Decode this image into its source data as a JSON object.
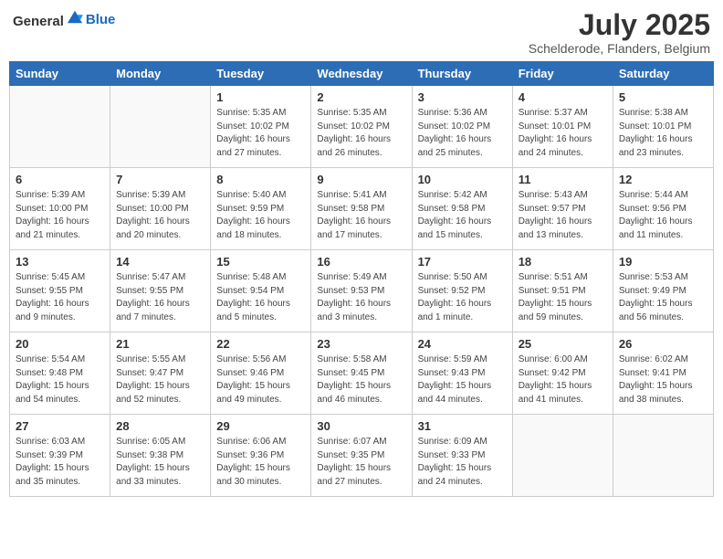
{
  "logo": {
    "general": "General",
    "blue": "Blue"
  },
  "header": {
    "month": "July 2025",
    "location": "Schelderode, Flanders, Belgium"
  },
  "weekdays": [
    "Sunday",
    "Monday",
    "Tuesday",
    "Wednesday",
    "Thursday",
    "Friday",
    "Saturday"
  ],
  "weeks": [
    [
      {
        "day": "",
        "info": ""
      },
      {
        "day": "",
        "info": ""
      },
      {
        "day": "1",
        "info": "Sunrise: 5:35 AM\nSunset: 10:02 PM\nDaylight: 16 hours and 27 minutes."
      },
      {
        "day": "2",
        "info": "Sunrise: 5:35 AM\nSunset: 10:02 PM\nDaylight: 16 hours and 26 minutes."
      },
      {
        "day": "3",
        "info": "Sunrise: 5:36 AM\nSunset: 10:02 PM\nDaylight: 16 hours and 25 minutes."
      },
      {
        "day": "4",
        "info": "Sunrise: 5:37 AM\nSunset: 10:01 PM\nDaylight: 16 hours and 24 minutes."
      },
      {
        "day": "5",
        "info": "Sunrise: 5:38 AM\nSunset: 10:01 PM\nDaylight: 16 hours and 23 minutes."
      }
    ],
    [
      {
        "day": "6",
        "info": "Sunrise: 5:39 AM\nSunset: 10:00 PM\nDaylight: 16 hours and 21 minutes."
      },
      {
        "day": "7",
        "info": "Sunrise: 5:39 AM\nSunset: 10:00 PM\nDaylight: 16 hours and 20 minutes."
      },
      {
        "day": "8",
        "info": "Sunrise: 5:40 AM\nSunset: 9:59 PM\nDaylight: 16 hours and 18 minutes."
      },
      {
        "day": "9",
        "info": "Sunrise: 5:41 AM\nSunset: 9:58 PM\nDaylight: 16 hours and 17 minutes."
      },
      {
        "day": "10",
        "info": "Sunrise: 5:42 AM\nSunset: 9:58 PM\nDaylight: 16 hours and 15 minutes."
      },
      {
        "day": "11",
        "info": "Sunrise: 5:43 AM\nSunset: 9:57 PM\nDaylight: 16 hours and 13 minutes."
      },
      {
        "day": "12",
        "info": "Sunrise: 5:44 AM\nSunset: 9:56 PM\nDaylight: 16 hours and 11 minutes."
      }
    ],
    [
      {
        "day": "13",
        "info": "Sunrise: 5:45 AM\nSunset: 9:55 PM\nDaylight: 16 hours and 9 minutes."
      },
      {
        "day": "14",
        "info": "Sunrise: 5:47 AM\nSunset: 9:55 PM\nDaylight: 16 hours and 7 minutes."
      },
      {
        "day": "15",
        "info": "Sunrise: 5:48 AM\nSunset: 9:54 PM\nDaylight: 16 hours and 5 minutes."
      },
      {
        "day": "16",
        "info": "Sunrise: 5:49 AM\nSunset: 9:53 PM\nDaylight: 16 hours and 3 minutes."
      },
      {
        "day": "17",
        "info": "Sunrise: 5:50 AM\nSunset: 9:52 PM\nDaylight: 16 hours and 1 minute."
      },
      {
        "day": "18",
        "info": "Sunrise: 5:51 AM\nSunset: 9:51 PM\nDaylight: 15 hours and 59 minutes."
      },
      {
        "day": "19",
        "info": "Sunrise: 5:53 AM\nSunset: 9:49 PM\nDaylight: 15 hours and 56 minutes."
      }
    ],
    [
      {
        "day": "20",
        "info": "Sunrise: 5:54 AM\nSunset: 9:48 PM\nDaylight: 15 hours and 54 minutes."
      },
      {
        "day": "21",
        "info": "Sunrise: 5:55 AM\nSunset: 9:47 PM\nDaylight: 15 hours and 52 minutes."
      },
      {
        "day": "22",
        "info": "Sunrise: 5:56 AM\nSunset: 9:46 PM\nDaylight: 15 hours and 49 minutes."
      },
      {
        "day": "23",
        "info": "Sunrise: 5:58 AM\nSunset: 9:45 PM\nDaylight: 15 hours and 46 minutes."
      },
      {
        "day": "24",
        "info": "Sunrise: 5:59 AM\nSunset: 9:43 PM\nDaylight: 15 hours and 44 minutes."
      },
      {
        "day": "25",
        "info": "Sunrise: 6:00 AM\nSunset: 9:42 PM\nDaylight: 15 hours and 41 minutes."
      },
      {
        "day": "26",
        "info": "Sunrise: 6:02 AM\nSunset: 9:41 PM\nDaylight: 15 hours and 38 minutes."
      }
    ],
    [
      {
        "day": "27",
        "info": "Sunrise: 6:03 AM\nSunset: 9:39 PM\nDaylight: 15 hours and 35 minutes."
      },
      {
        "day": "28",
        "info": "Sunrise: 6:05 AM\nSunset: 9:38 PM\nDaylight: 15 hours and 33 minutes."
      },
      {
        "day": "29",
        "info": "Sunrise: 6:06 AM\nSunset: 9:36 PM\nDaylight: 15 hours and 30 minutes."
      },
      {
        "day": "30",
        "info": "Sunrise: 6:07 AM\nSunset: 9:35 PM\nDaylight: 15 hours and 27 minutes."
      },
      {
        "day": "31",
        "info": "Sunrise: 6:09 AM\nSunset: 9:33 PM\nDaylight: 15 hours and 24 minutes."
      },
      {
        "day": "",
        "info": ""
      },
      {
        "day": "",
        "info": ""
      }
    ]
  ]
}
